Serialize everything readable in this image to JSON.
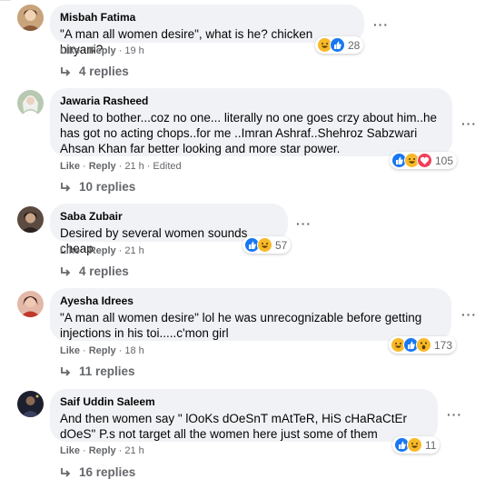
{
  "comments": [
    {
      "name": "Misbah Fatima",
      "text": "\"A man all women desire\", what is he? chicken biryani?",
      "like": "Like",
      "reply": "Reply",
      "time": "19 h",
      "edited": "",
      "reaction_count": "28",
      "reactions": [
        "haha",
        "like"
      ],
      "replies": "4 replies",
      "avatar_color": "#c9a37a"
    },
    {
      "name": "Jawaria Rasheed",
      "text": "Need to bother...coz no one... literally no one goes crzy about him..he has got no acting chops..for me ..Imran Ashraf..Shehroz Sabzwari Ahsan Khan far better looking and more star power.",
      "like": "Like",
      "reply": "Reply",
      "time": "21 h",
      "edited": "Edited",
      "reaction_count": "105",
      "reactions": [
        "like",
        "haha",
        "love"
      ],
      "replies": "10 replies",
      "avatar_color": "#b7c9b0"
    },
    {
      "name": "Saba Zubair",
      "text": "Desired by several women sounds cheap",
      "like": "Like",
      "reply": "Reply",
      "time": "21 h",
      "edited": "",
      "reaction_count": "57",
      "reactions": [
        "like",
        "haha"
      ],
      "replies": "4 replies",
      "avatar_color": "#6b5a4f"
    },
    {
      "name": "Ayesha Idrees",
      "text": "\"A man all women desire\" lol he was unrecognizable before getting injections in his toi.....c'mon girl",
      "like": "Like",
      "reply": "Reply",
      "time": "18 h",
      "edited": "",
      "reaction_count": "173",
      "reactions": [
        "haha",
        "like",
        "wow"
      ],
      "replies": "11 replies",
      "avatar_color": "#d89a8a"
    },
    {
      "name": "Saif Uddin Saleem",
      "text": "And then women say \" lOoKs dOeSnT mAtTeR, HiS cHaRaCtEr dOeS\" P.s not target all the women here just some of them",
      "like": "Like",
      "reply": "Reply",
      "time": "21 h",
      "edited": "",
      "reaction_count": "11",
      "reactions": [
        "like",
        "haha"
      ],
      "replies": "16 replies",
      "avatar_color": "#2a2a3a"
    }
  ],
  "more_label": "···",
  "dot": "·"
}
